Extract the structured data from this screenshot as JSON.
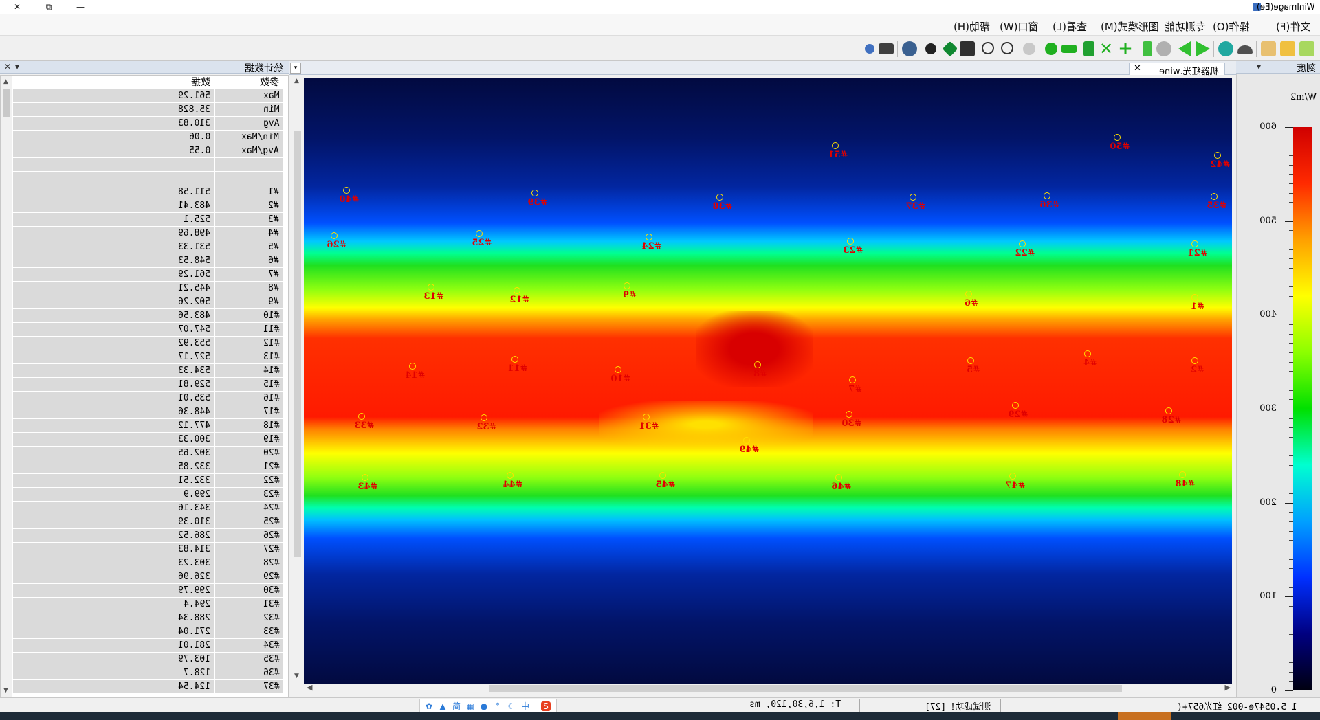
{
  "window": {
    "title": "WinImage(Ee)",
    "close_glyph": "✕",
    "restore_glyph": "⧉",
    "minimize_glyph": "—"
  },
  "menu": [
    "文件(F)",
    "操作(O)",
    "专测功能",
    "图形模式(M)",
    "查看(L)",
    "窗口(W)",
    "帮助(H)"
  ],
  "toolbar_icons": [
    "new-file-icon",
    "open-folder-icon",
    "open-image-icon",
    "eject-icon",
    "settings-icon",
    "play-icon",
    "step-back-icon",
    "marker-icon",
    "add-icon",
    "delete-x-icon",
    "trash-icon",
    "rect-icon",
    "circle-icon",
    "disabled-icon-1",
    "disabled-icon-2",
    "zoom-in-icon",
    "zoom-out-icon",
    "fit-icon",
    "nav-icon",
    "brightness-icon",
    "color-wheel-icon",
    "print-icon",
    "help-icon"
  ],
  "stats_panel": {
    "title": "统计数据",
    "pin_glyph": "▾",
    "close_glyph": "✕",
    "columns": [
      "参数",
      "数据"
    ],
    "rows": [
      {
        "param": "Max",
        "value": "561.29"
      },
      {
        "param": "Min",
        "value": "35.828"
      },
      {
        "param": "Avg",
        "value": "310.83"
      },
      {
        "param": "Min/Max",
        "value": "0.06"
      },
      {
        "param": "Avg/Max",
        "value": "0.55"
      },
      {
        "param": "",
        "value": ""
      },
      {
        "param": "",
        "value": ""
      },
      {
        "param": "#1",
        "value": "511.58"
      },
      {
        "param": "#2",
        "value": "483.41"
      },
      {
        "param": "#3",
        "value": "525.1"
      },
      {
        "param": "#4",
        "value": "498.69"
      },
      {
        "param": "#5",
        "value": "531.33"
      },
      {
        "param": "#6",
        "value": "548.53"
      },
      {
        "param": "#7",
        "value": "561.29"
      },
      {
        "param": "#8",
        "value": "445.21"
      },
      {
        "param": "#9",
        "value": "502.26"
      },
      {
        "param": "#10",
        "value": "483.56"
      },
      {
        "param": "#11",
        "value": "547.07"
      },
      {
        "param": "#12",
        "value": "553.92"
      },
      {
        "param": "#13",
        "value": "527.17"
      },
      {
        "param": "#14",
        "value": "534.33"
      },
      {
        "param": "#15",
        "value": "529.81"
      },
      {
        "param": "#16",
        "value": "535.01"
      },
      {
        "param": "#17",
        "value": "448.36"
      },
      {
        "param": "#18",
        "value": "477.12"
      },
      {
        "param": "#19",
        "value": "300.33"
      },
      {
        "param": "#20",
        "value": "302.65"
      },
      {
        "param": "#21",
        "value": "332.85"
      },
      {
        "param": "#22",
        "value": "332.51"
      },
      {
        "param": "#23",
        "value": "299.9"
      },
      {
        "param": "#24",
        "value": "343.16"
      },
      {
        "param": "#25",
        "value": "310.39"
      },
      {
        "param": "#26",
        "value": "286.52"
      },
      {
        "param": "#27",
        "value": "314.83"
      },
      {
        "param": "#28",
        "value": "303.23"
      },
      {
        "param": "#29",
        "value": "326.96"
      },
      {
        "param": "#30",
        "value": "299.79"
      },
      {
        "param": "#31",
        "value": "294.4"
      },
      {
        "param": "#32",
        "value": "288.34"
      },
      {
        "param": "#33",
        "value": "271.04"
      },
      {
        "param": "#34",
        "value": "281.01"
      },
      {
        "param": "#35",
        "value": "103.79"
      },
      {
        "param": "#36",
        "value": "128.7"
      },
      {
        "param": "#37",
        "value": "124.54"
      }
    ]
  },
  "document": {
    "tab_title": "机器红光.wine",
    "close_glyph": "✕",
    "dropdown_glyph": "▾"
  },
  "markers": [
    {
      "label": "#1"
    },
    {
      "label": "#2"
    },
    {
      "label": "#4"
    },
    {
      "label": "#5"
    },
    {
      "label": "#6"
    },
    {
      "label": "#7"
    },
    {
      "label": "#8"
    },
    {
      "label": "#9"
    },
    {
      "label": "#10"
    },
    {
      "label": "#11"
    },
    {
      "label": "#12"
    },
    {
      "label": "#13"
    },
    {
      "label": "#14"
    },
    {
      "label": "#21"
    },
    {
      "label": "#22"
    },
    {
      "label": "#23"
    },
    {
      "label": "#24"
    },
    {
      "label": "#25"
    },
    {
      "label": "#26"
    },
    {
      "label": "#28"
    },
    {
      "label": "#29"
    },
    {
      "label": "#30"
    },
    {
      "label": "#31"
    },
    {
      "label": "#32"
    },
    {
      "label": "#33"
    },
    {
      "label": "#35"
    },
    {
      "label": "#36"
    },
    {
      "label": "#37"
    },
    {
      "label": "#38"
    },
    {
      "label": "#39"
    },
    {
      "label": "#40"
    },
    {
      "label": "#42"
    },
    {
      "label": "#43"
    },
    {
      "label": "#44"
    },
    {
      "label": "#45"
    },
    {
      "label": "#46"
    },
    {
      "label": "#47"
    },
    {
      "label": "#48"
    },
    {
      "label": "#49"
    },
    {
      "label": "#50"
    },
    {
      "label": "#51"
    }
  ],
  "legend": {
    "title": "刻度",
    "unit": "W/m2",
    "ticks": [
      "600",
      "500",
      "400",
      "300",
      "200",
      "100",
      "0"
    ],
    "colors": [
      "#d00000",
      "#ff2a00",
      "#ffa000",
      "#ffff00",
      "#8cff00",
      "#00e000",
      "#00ffd0",
      "#00a0ff",
      "#0030ff",
      "#000080",
      "#000010"
    ]
  },
  "status": {
    "coord": "1 5.0547e-002 红光657+(",
    "message": "测试成功！[27]",
    "params": "T: 1,6,30,120, ms"
  }
}
